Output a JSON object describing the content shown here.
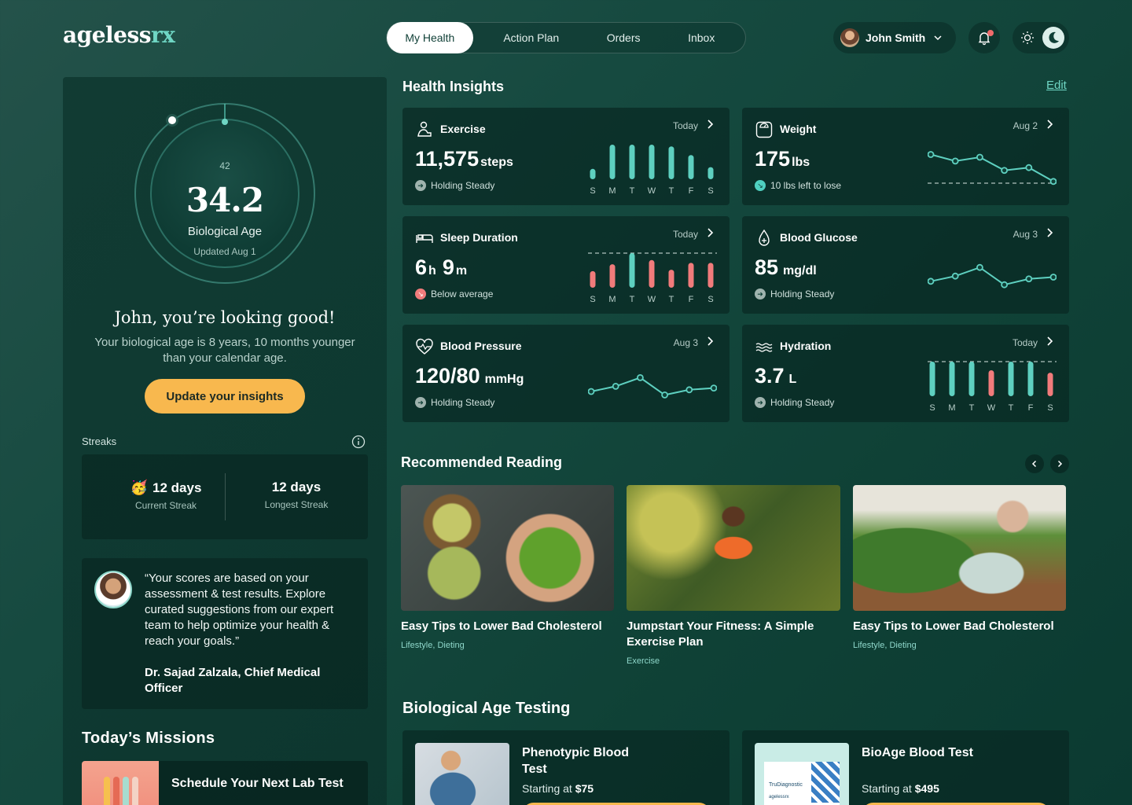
{
  "app": {
    "logo_main": "ageless",
    "logo_accent": "rx"
  },
  "nav": {
    "tabs": [
      {
        "label": "My Health",
        "active": true
      },
      {
        "label": "Action Plan",
        "active": false
      },
      {
        "label": "Orders",
        "active": false
      },
      {
        "label": "Inbox",
        "active": false
      }
    ]
  },
  "user": {
    "name": "John Smith"
  },
  "bio": {
    "ring_small": "42",
    "age": "34.2",
    "label": "Biological Age",
    "updated": "Updated Aug 1",
    "greeting": "John, you’re looking good!",
    "subtext": "Your biological age is 8 years, 10 months younger than your calendar age.",
    "button": "Update your insights"
  },
  "streaks": {
    "title": "Streaks",
    "current_value": "12 days",
    "current_label": "Current Streak",
    "longest_value": "12 days",
    "longest_label": "Longest Streak"
  },
  "quote": {
    "text": "“Your scores are based on your assessment & test results. Explore curated suggestions from our expert team to help optimize your health & reach your goals.”",
    "author": "Dr. Sajad Zalzala, Chief Medical Officer"
  },
  "missions": {
    "title": "Today’s Missions",
    "item": "Schedule Your Next Lab Test"
  },
  "insights": {
    "title": "Health Insights",
    "edit": "Edit",
    "cards": {
      "exercise": {
        "title": "Exercise",
        "date": "Today",
        "value": "11,575",
        "unit": "steps",
        "status": "Holding Steady"
      },
      "weight": {
        "title": "Weight",
        "date": "Aug 2",
        "value": "175",
        "unit": "lbs",
        "status": "10 lbs left to lose"
      },
      "sleep": {
        "title": "Sleep Duration",
        "date": "Today",
        "value_h": "6",
        "unit_h": "h",
        "value_m": "9",
        "unit_m": "m",
        "status": "Below average"
      },
      "glucose": {
        "title": "Blood Glucose",
        "date": "Aug 3",
        "value": "85",
        "unit": "mg/dl",
        "status": "Holding Steady"
      },
      "pressure": {
        "title": "Blood Pressure",
        "date": "Aug 3",
        "value": "120/80",
        "unit": "mmHg",
        "status": "Holding Steady"
      },
      "hydration": {
        "title": "Hydration",
        "date": "Today",
        "value": "3.7",
        "unit": "L",
        "status": "Holding Steady"
      }
    }
  },
  "chart_data": [
    {
      "type": "bar",
      "name": "exercise",
      "categories": [
        "S",
        "M",
        "T",
        "W",
        "T",
        "F",
        "S"
      ],
      "values": [
        0.3,
        1.0,
        1.0,
        1.0,
        0.95,
        0.7,
        0.35
      ]
    },
    {
      "type": "line",
      "name": "weight",
      "values": [
        0.83,
        0.64,
        0.75,
        0.37,
        0.45,
        0.05
      ]
    },
    {
      "type": "bar",
      "name": "sleep",
      "categories": [
        "S",
        "M",
        "T",
        "W",
        "T",
        "F",
        "S"
      ],
      "values": [
        0.48,
        0.68,
        1.0,
        0.8,
        0.52,
        0.72,
        0.72
      ],
      "target": 1.0
    },
    {
      "type": "line",
      "name": "glucose",
      "values": [
        0.3,
        0.45,
        0.7,
        0.2,
        0.37,
        0.42
      ]
    },
    {
      "type": "line",
      "name": "pressure",
      "values": [
        0.25,
        0.4,
        0.65,
        0.15,
        0.3,
        0.35
      ]
    },
    {
      "type": "bar",
      "name": "hydration",
      "categories": [
        "S",
        "M",
        "T",
        "W",
        "T",
        "F",
        "S"
      ],
      "values": [
        1.0,
        1.0,
        1.0,
        0.75,
        1.0,
        1.0,
        0.68
      ],
      "target": 1.0
    }
  ],
  "colors": {
    "accent": "#6fd6c4",
    "teal_bar": "#5ed0c0",
    "coral_bar": "#f17b7b",
    "cta": "#f8b84e"
  },
  "reading": {
    "title": "Recommended Reading",
    "articles": [
      {
        "title": "Easy Tips to Lower Bad Cholesterol",
        "tags": "Lifestyle, Dieting"
      },
      {
        "title": "Jumpstart Your Fitness: A Simple Exercise Plan",
        "tags": "Exercise"
      },
      {
        "title": "Easy Tips to Lower Bad Cholesterol",
        "tags": "Lifestyle, Dieting"
      }
    ]
  },
  "testing": {
    "title": "Biological Age Testing",
    "tests": [
      {
        "title": "Phenotypic Blood Test",
        "price_label": "Starting at",
        "price": "$75"
      },
      {
        "title": "BioAge Blood Test",
        "price_label": "Starting at",
        "price": "$495",
        "thumb_brand": "TruDiagnostic",
        "thumb_sub": "agelessrx"
      }
    ]
  }
}
